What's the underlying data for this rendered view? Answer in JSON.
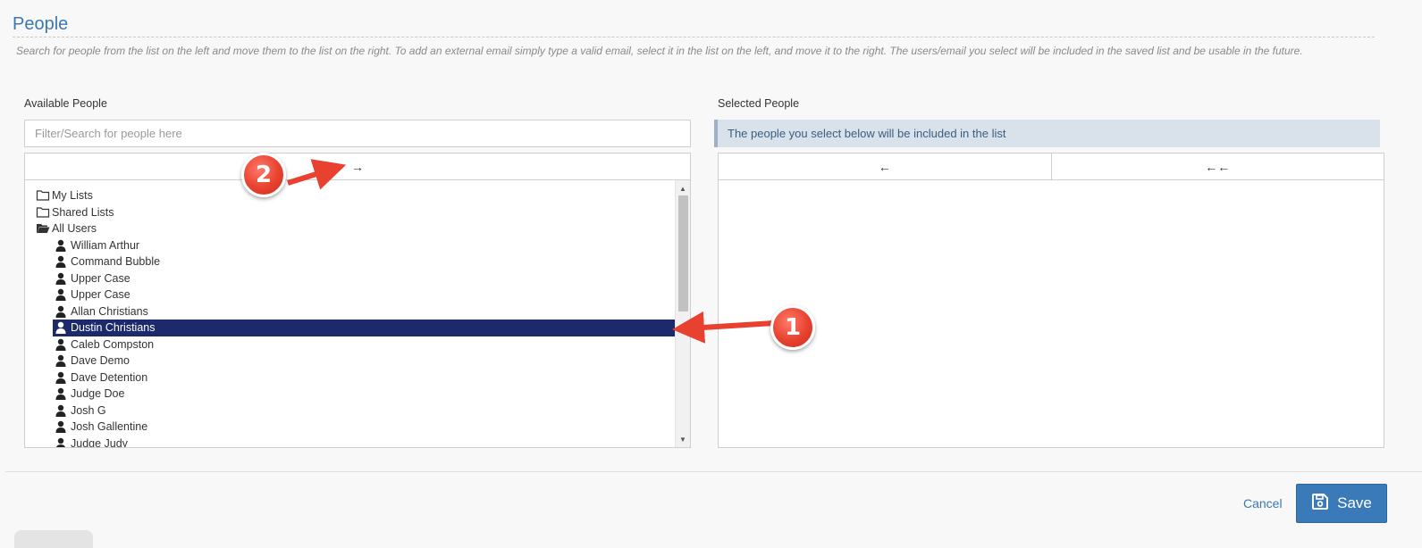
{
  "page": {
    "title": "People",
    "instructions": "Search for people from the list on the left and move them to the list on the right. To add an external email simply type a valid email, select it in the list on the left, and move it to the right. The users/email you select will be included in the saved list and be usable in the future."
  },
  "available": {
    "label": "Available People",
    "search_placeholder": "Filter/Search for people here",
    "move_right_button": "→",
    "folders": [
      {
        "label": "My Lists",
        "icon": "folder-icon"
      },
      {
        "label": "Shared Lists",
        "icon": "folder-icon"
      },
      {
        "label": "All Users",
        "icon": "folder-open-icon"
      }
    ],
    "users": [
      {
        "label": "William Arthur",
        "selected": false
      },
      {
        "label": "Command Bubble",
        "selected": false
      },
      {
        "label": "Upper Case",
        "selected": false
      },
      {
        "label": "Upper Case",
        "selected": false
      },
      {
        "label": "Allan Christians",
        "selected": false
      },
      {
        "label": "Dustin Christians",
        "selected": true
      },
      {
        "label": "Caleb Compston",
        "selected": false
      },
      {
        "label": "Dave Demo",
        "selected": false
      },
      {
        "label": "Dave Detention",
        "selected": false
      },
      {
        "label": "Judge Doe",
        "selected": false
      },
      {
        "label": "Josh G",
        "selected": false
      },
      {
        "label": "Josh Gallentine",
        "selected": false
      },
      {
        "label": "Judge Judy",
        "selected": false
      }
    ]
  },
  "selected": {
    "label": "Selected People",
    "info": "The people you select below will be included in the list",
    "move_left_button": "←",
    "move_all_left_button": "←←"
  },
  "footer": {
    "cancel_label": "Cancel",
    "save_label": "Save"
  },
  "annotations": {
    "badge_1": "1",
    "badge_2": "2"
  },
  "colors": {
    "accent": "#3a79b0",
    "selection": "#1c2a6b",
    "save_button": "#3a7ab8",
    "annotation_red": "#e8412f"
  }
}
